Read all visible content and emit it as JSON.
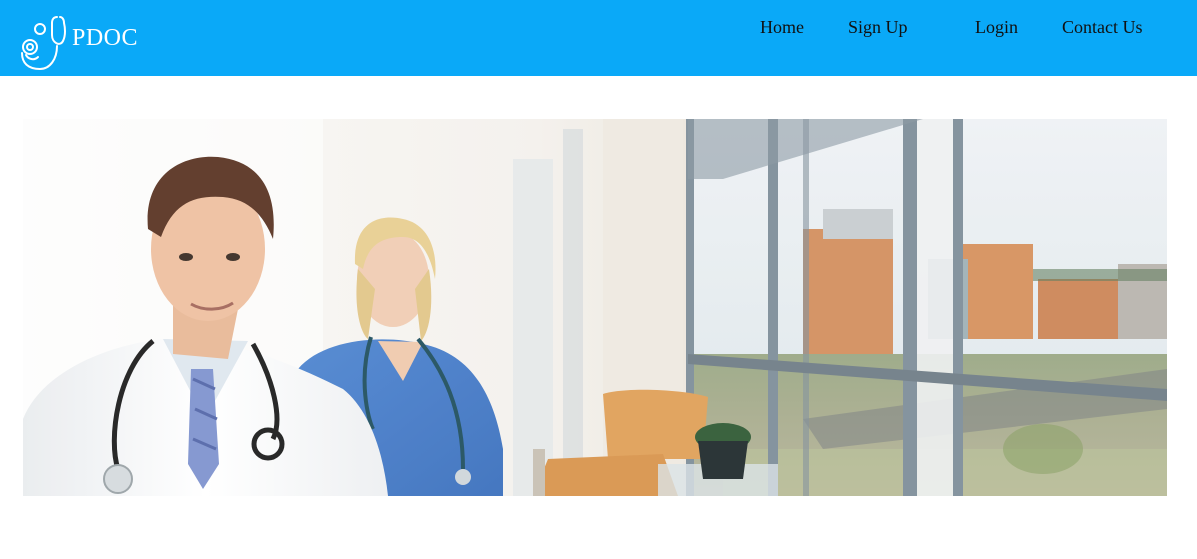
{
  "brand": {
    "name": "PDOC",
    "logo_icon": "stethoscope-icon"
  },
  "nav": {
    "items": [
      {
        "label": "Home"
      },
      {
        "label": "Sign Up"
      },
      {
        "label": "Login"
      },
      {
        "label": "Contact Us"
      }
    ]
  },
  "colors": {
    "navbar": "#0aa9f8",
    "nav_text": "#111111",
    "brand_text": "#ffffff",
    "page_background": "#ffffff"
  },
  "hero": {
    "image_description": "Male doctor in white coat with stethoscope and female nurse in blue scrubs in a bright hospital corridor with large windows overlooking buildings"
  }
}
